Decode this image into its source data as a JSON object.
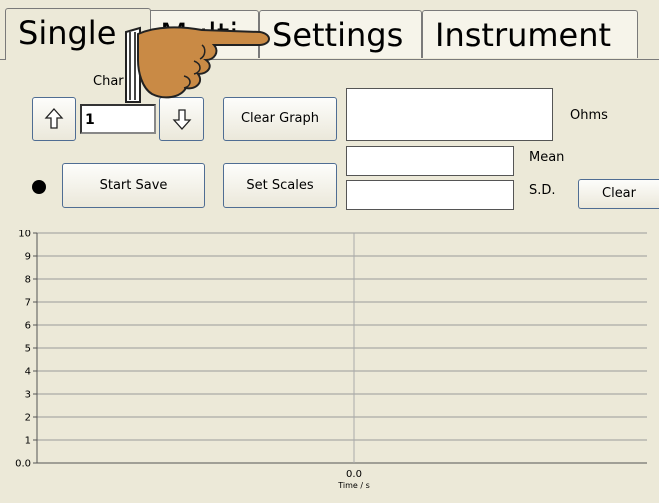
{
  "tabs": [
    {
      "label": "Single"
    },
    {
      "label": "Multi"
    },
    {
      "label": "Settings"
    },
    {
      "label": "Instrument"
    }
  ],
  "channel": {
    "label": "Char",
    "value": "1"
  },
  "buttons": {
    "clear_graph": "Clear Graph",
    "start_save": "Start Save",
    "set_scales": "Set Scales",
    "clear": "Clear"
  },
  "readouts": {
    "resistance_value": "",
    "resistance_unit": "Ohms",
    "mean_value": "",
    "mean_label": "Mean",
    "sd_value": "",
    "sd_label": "S.D."
  },
  "chart_data": {
    "type": "line",
    "x": [],
    "series": [],
    "title": "",
    "xlabel": "Time / s",
    "ylabel": "",
    "ylim": [
      0,
      10
    ],
    "yticks": [
      "0.0",
      "1",
      "2",
      "3",
      "4",
      "5",
      "6",
      "7",
      "8",
      "9",
      "10"
    ],
    "xticks": [
      "0.0"
    ],
    "grid": true
  }
}
